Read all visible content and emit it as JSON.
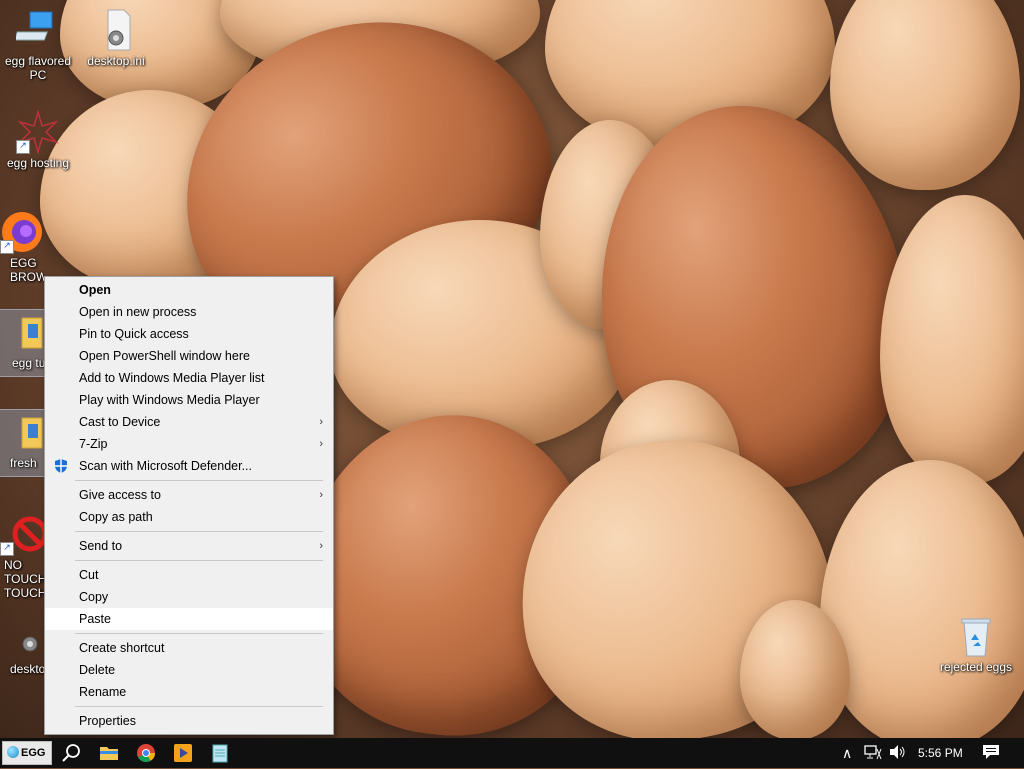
{
  "desktop": {
    "icons": [
      {
        "label": "egg flavored PC"
      },
      {
        "label": "desktop.ini"
      },
      {
        "label": "egg hosting"
      },
      {
        "label": "EGG BROWSER"
      },
      {
        "label": "egg tu"
      },
      {
        "label": "fresh"
      },
      {
        "label": "NO TOUCH TOUCH"
      },
      {
        "label": "deskto"
      },
      {
        "label": "rejected eggs"
      }
    ]
  },
  "context_menu": {
    "items": [
      {
        "label": "Open"
      },
      {
        "label": "Open in new process"
      },
      {
        "label": "Pin to Quick access"
      },
      {
        "label": "Open PowerShell window here"
      },
      {
        "label": "Add to Windows Media Player list"
      },
      {
        "label": "Play with Windows Media Player"
      },
      {
        "label": "Cast to Device"
      },
      {
        "label": "7-Zip"
      },
      {
        "label": "Scan with Microsoft Defender..."
      },
      {
        "label": "Give access to"
      },
      {
        "label": "Copy as path"
      },
      {
        "label": "Send to"
      },
      {
        "label": "Cut"
      },
      {
        "label": "Copy"
      },
      {
        "label": "Paste"
      },
      {
        "label": "Create shortcut"
      },
      {
        "label": "Delete"
      },
      {
        "label": "Rename"
      },
      {
        "label": "Properties"
      }
    ],
    "submenu_glyph": "›"
  },
  "taskbar": {
    "start_label": "EGG",
    "clock": "5:56 PM",
    "tray_up_glyph": "∧"
  },
  "colors": {
    "menu_bg": "#f0f0f0",
    "menu_hover": "#ffffff",
    "taskbar_bg": "#101010"
  }
}
